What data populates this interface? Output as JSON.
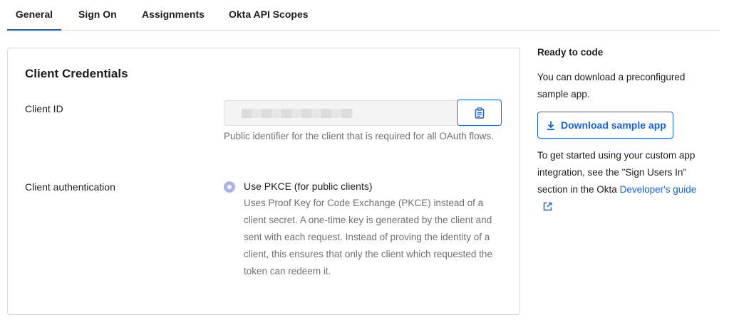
{
  "tabs": [
    {
      "label": "General",
      "active": true
    },
    {
      "label": "Sign On",
      "active": false
    },
    {
      "label": "Assignments",
      "active": false
    },
    {
      "label": "Okta API Scopes",
      "active": false
    }
  ],
  "credentials": {
    "title": "Client Credentials",
    "client_id_label": "Client ID",
    "client_id_help": "Public identifier for the client that is required for all OAuth flows.",
    "copy_icon": "clipboard-icon",
    "client_auth_label": "Client authentication",
    "pkce_option_label": "Use PKCE (for public clients)",
    "pkce_option_desc": "Uses Proof Key for Code Exchange (PKCE) instead of a client secret. A one-time key is generated by the client and sent with each request. Instead of proving the identity of a client, this ensures that only the client which requested the token can redeem it."
  },
  "sidebar": {
    "title": "Ready to code",
    "desc": "You can download a preconfigured sample app.",
    "download_button": "Download sample app",
    "info_text": "To get started using your custom app integration, see the \"Sign Users In\" section in the Okta",
    "guide_link": "Developer's guide"
  },
  "colors": {
    "accent": "#1662dd",
    "radio_selected": "#a7b3e8",
    "border": "#d7d7dc"
  }
}
